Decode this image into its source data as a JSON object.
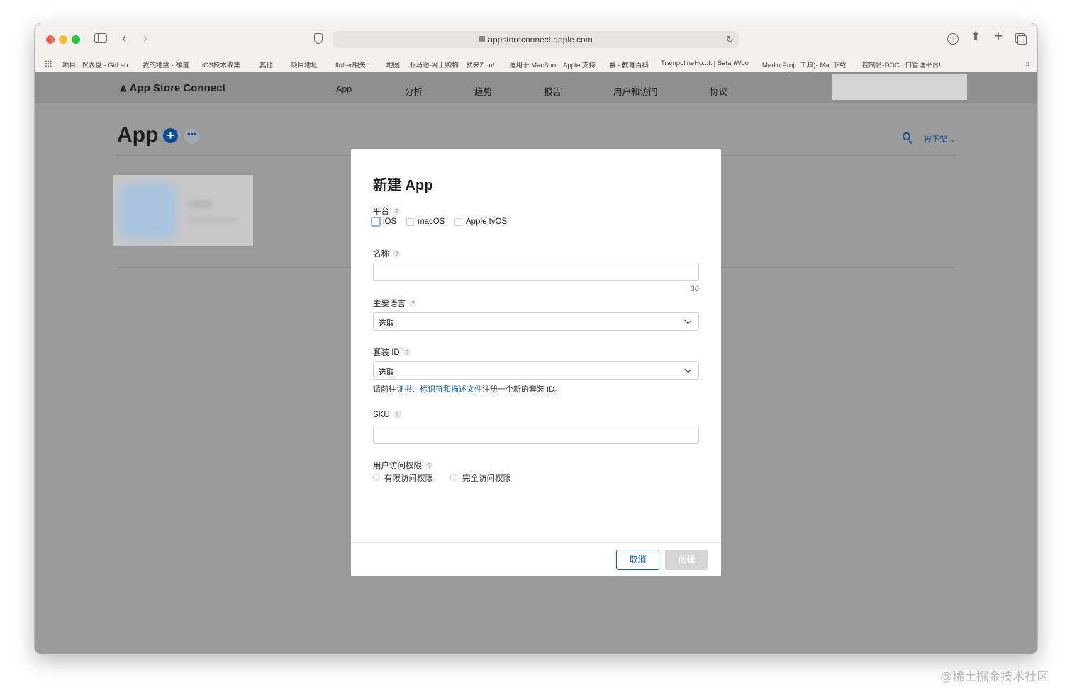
{
  "browser": {
    "url": "appstoreconnect.apple.com",
    "bookmarks": [
      "项目 · 仪表盘 · GitLab",
      "我的地盘 - 禅道",
      "iOS技术收集",
      "其他",
      "项目地址",
      "flutter相关",
      "地图",
      "亚马逊-网上购物... 就来Z.cn!",
      "适用于 MacBoo... Apple 支持",
      "鬟 - 教育百科",
      "TrampolineHo...k | SatanWoo",
      "Merlin Proj...工具)- Mac下载",
      "控制台-DOC...口管理平台!"
    ]
  },
  "nav": {
    "brand": "App Store Connect",
    "items": [
      "App",
      "分析",
      "趋势",
      "报告",
      "用户和访问",
      "协议"
    ]
  },
  "apps_page": {
    "title": "App",
    "add_icon": "+",
    "more_icon": "•••",
    "filter_label": "被下架 ⌄"
  },
  "modal": {
    "title": "新建 App",
    "platform_label": "平台",
    "platforms": [
      "iOS",
      "macOS",
      "Apple tvOS"
    ],
    "name_label": "名称",
    "name_value": "",
    "name_counter": "30",
    "language_label": "主要语言",
    "language_value": "选取",
    "bundle_label": "套装 ID",
    "bundle_value": "选取",
    "hint_prefix": "请前往",
    "hint_link1": "证书、标识符和描述文件",
    "hint_suffix": "注册一个新的套装 ID。",
    "sku_label": "SKU",
    "sku_value": "",
    "access_label": "用户访问权限",
    "access_options": [
      "有限访问权限",
      "完全访问权限"
    ],
    "help_mark": "?",
    "cancel_label": "取消",
    "create_label": "创建"
  },
  "watermark": "@稀土掘金技术社区"
}
